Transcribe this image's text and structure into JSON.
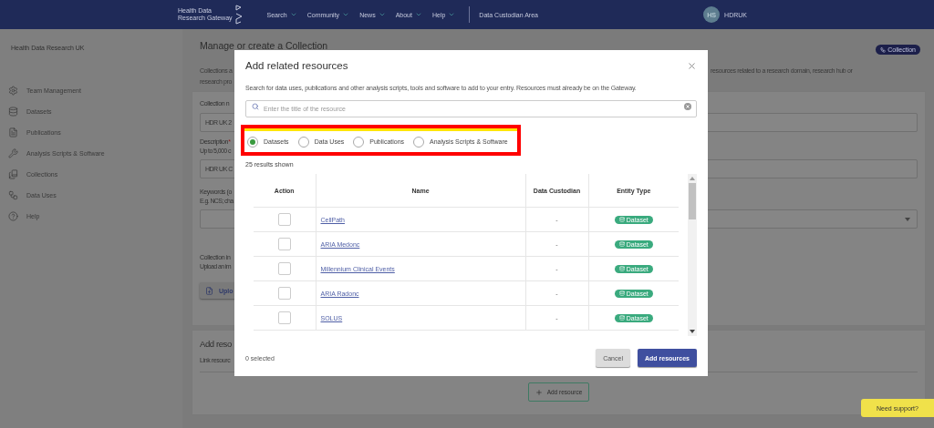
{
  "navbar": {
    "logo_lines": [
      "Health Data",
      "Research Gateway"
    ],
    "nav_items": [
      {
        "label": "Search",
        "dropdown": true
      },
      {
        "label": "Community",
        "dropdown": true
      },
      {
        "label": "News",
        "dropdown": true
      },
      {
        "label": "About",
        "dropdown": true
      },
      {
        "label": "Help",
        "dropdown": true
      }
    ],
    "area_link": "Data Custodian Area",
    "user": {
      "initials": "HS",
      "name": "HDRUK"
    }
  },
  "sidebar": {
    "title": "Health Data Research UK",
    "items": [
      {
        "label": "Team Management"
      },
      {
        "label": "Datasets"
      },
      {
        "label": "Publications"
      },
      {
        "label": "Analysis Scripts & Software"
      },
      {
        "label": "Collections"
      },
      {
        "label": "Data Uses"
      },
      {
        "label": "Help"
      }
    ]
  },
  "page": {
    "title": "Manage or create a Collection",
    "badge": "Collection",
    "intro": [
      {
        "left": "Collections a",
        "right": "resources related to a research domain, research hub or"
      },
      {
        "left": "research pro"
      }
    ],
    "form_fields": [
      {
        "kind": "text",
        "label": "Collection n",
        "value": "HDR UK 2"
      },
      {
        "kind": "text",
        "label": "Description",
        "required_mark": "*",
        "hint": "Up to 5,000 c",
        "value": "HDR UK C"
      },
      {
        "kind": "select",
        "label": "Keywords (o",
        "hint": "E.g. NCS; cha"
      },
      {
        "kind": "upload",
        "label": "Collection in",
        "hint": "Upload an im",
        "button": "Uplo"
      }
    ],
    "resources_card": {
      "title": "Add reso",
      "text": "Link resourc",
      "button": "Add resource"
    }
  },
  "modal": {
    "title": "Add related resources",
    "description": "Search for data uses, publications and other analysis scripts, tools and software to add to your entry. Resources must already be on the Gateway.",
    "search": {
      "placeholder": "Enter the title of the resource"
    },
    "options": [
      {
        "label": "Datasets",
        "selected": true
      },
      {
        "label": "Data Uses",
        "selected": false
      },
      {
        "label": "Publications",
        "selected": false
      },
      {
        "label": "Analysis Scripts & Software",
        "selected": false
      }
    ],
    "results": "25 results shown",
    "table": {
      "columns": [
        "Action",
        "Name",
        "Data Custodian",
        "Entity Type"
      ],
      "rows": [
        {
          "checked": false,
          "name": "CellPath",
          "custodian": "-",
          "type": "Dataset"
        },
        {
          "checked": false,
          "name": "ARIA Medonc",
          "custodian": "-",
          "type": "Dataset"
        },
        {
          "checked": false,
          "name": "Millennium Clinical Events",
          "custodian": "-",
          "type": "Dataset"
        },
        {
          "checked": false,
          "name": "ARIA Radonc",
          "custodian": "-",
          "type": "Dataset"
        },
        {
          "checked": false,
          "name": "SOLUS",
          "custodian": "-",
          "type": "Dataset"
        }
      ]
    },
    "selected_count": "0 selected",
    "buttons": {
      "cancel": "Cancel",
      "confirm": "Add resources"
    }
  },
  "support_button": "Need support?"
}
